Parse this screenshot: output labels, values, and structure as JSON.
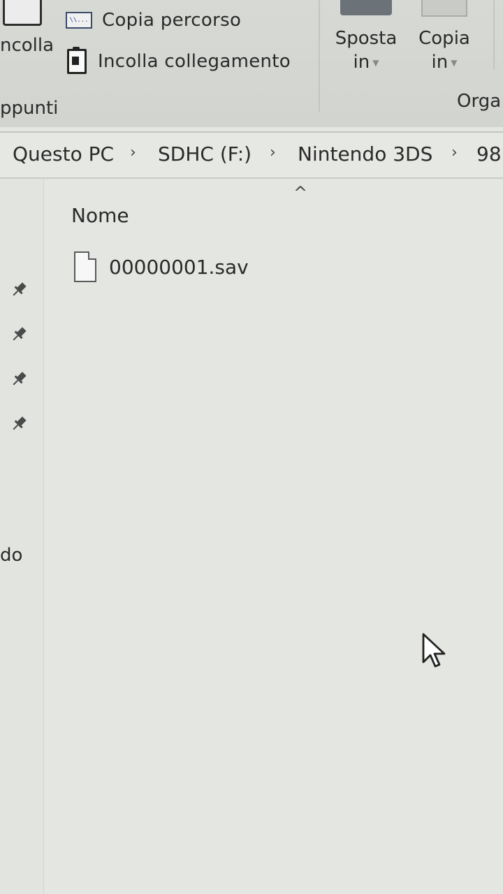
{
  "ribbon": {
    "paste_label": "ncolla",
    "copy_path_icon_text": "\\\\...",
    "copy_path_label": "Copia percorso",
    "paste_link_label": "Incolla collegamento",
    "clipboard_group_label": "ppunti",
    "move_to": {
      "line1": "Sposta",
      "line2": "in"
    },
    "copy_to": {
      "line1": "Copia",
      "line2": "in"
    },
    "organize_group_label": "Orga"
  },
  "breadcrumb": {
    "items": [
      "Questo PC",
      "SDHC (F:)",
      "Nintendo 3DS",
      "98"
    ],
    "separator": "›"
  },
  "file_list": {
    "sort_indicator": "^",
    "column_name": "Nome",
    "files": [
      {
        "name": "00000001.sav"
      }
    ]
  },
  "nav_pane": {
    "partial_label": "do",
    "pinned_count": 4
  },
  "colors": {
    "background": "#e4e6e2",
    "ribbon": "#d5d7d3",
    "text": "#2a2a2a"
  }
}
